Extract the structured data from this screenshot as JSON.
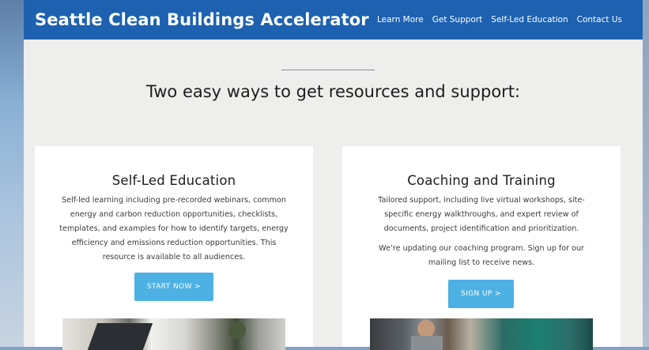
{
  "site": {
    "brand": "Seattle Clean Buildings Accelerator",
    "nav": [
      "Learn More",
      "Get Support",
      "Self-Led Education",
      "Contact Us"
    ]
  },
  "section": {
    "headline": "Two easy ways to get resources and support:"
  },
  "cards": [
    {
      "title": "Self-Led Education",
      "description": "Self-led learning including pre-recorded webinars, common energy and carbon reduction opportunities, checklists, templates, and examples for how to identify targets, energy efficiency and emissions reduction opportunities. This resource is available to all audiences.",
      "button": "START NOW >"
    },
    {
      "title": "Coaching and Training",
      "description": "Tailored support, including live virtual workshops, site-specific energy walkthroughs, and expert review of documents, project identification and prioritization.",
      "note": "We’re updating our coaching program. Sign up for our mailing list to receive news.",
      "button": "SIGN UP >"
    }
  ],
  "colors": {
    "header_bg": "#1d61b0",
    "button_bg": "#4eb1e4",
    "page_bg": "#eeeeec"
  }
}
